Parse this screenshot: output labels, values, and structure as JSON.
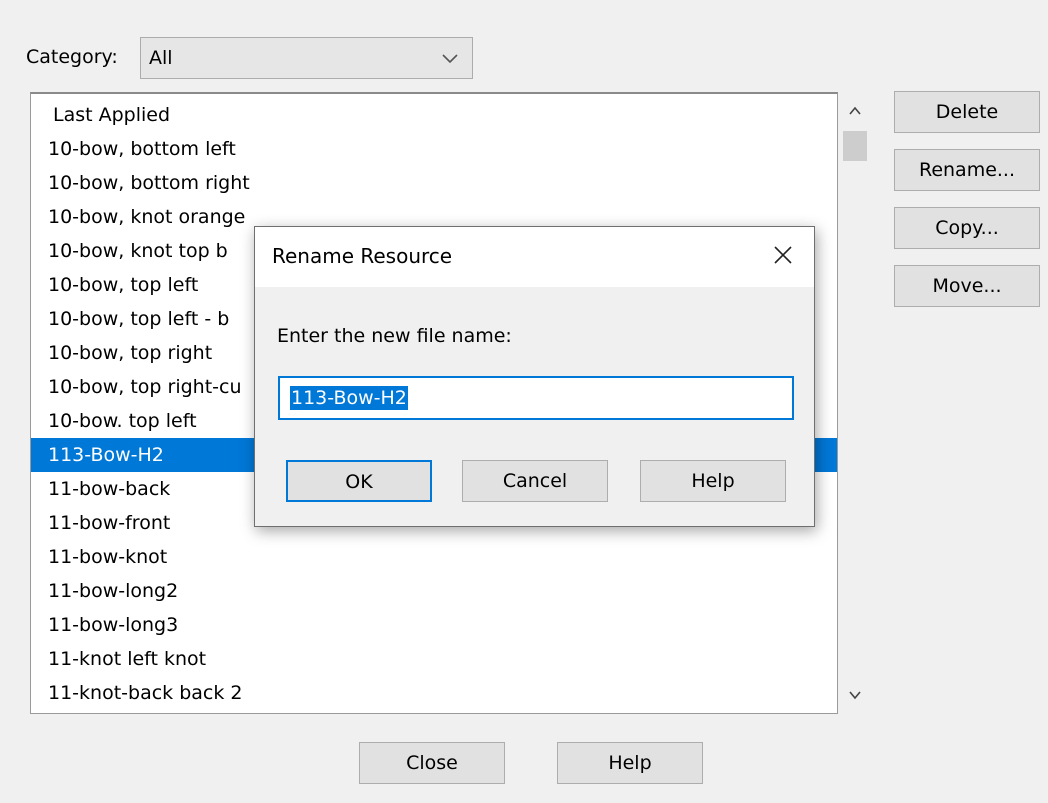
{
  "category": {
    "label": "Category:",
    "selected": "All",
    "chevron_icon": "chevron-down-icon"
  },
  "list": {
    "items": [
      "Last Applied",
      "10-bow, bottom left",
      "10-bow, bottom right",
      "10-bow, knot orange",
      "10-bow, knot top b",
      "10-bow, top left",
      "10-bow, top left - b",
      "10-bow, top right",
      "10-bow, top right-cu",
      "10-bow. top left",
      "113-Bow-H2",
      "11-bow-back",
      "11-bow-front",
      "11-bow-knot",
      "11-bow-long2",
      "11-bow-long3",
      "11-knot left knot",
      "11-knot-back back 2"
    ],
    "selected_index": 10
  },
  "side_buttons": {
    "delete": "Delete",
    "rename": "Rename...",
    "copy": "Copy...",
    "move": "Move..."
  },
  "bottom_buttons": {
    "close": "Close",
    "help": "Help"
  },
  "dialog": {
    "title": "Rename Resource",
    "prompt": "Enter the new file name:",
    "input_value": "113-Bow-H2",
    "ok": "OK",
    "cancel": "Cancel",
    "help": "Help"
  },
  "colors": {
    "selection": "#0078d7",
    "background": "#f0f0f0",
    "button": "#e1e1e1"
  }
}
